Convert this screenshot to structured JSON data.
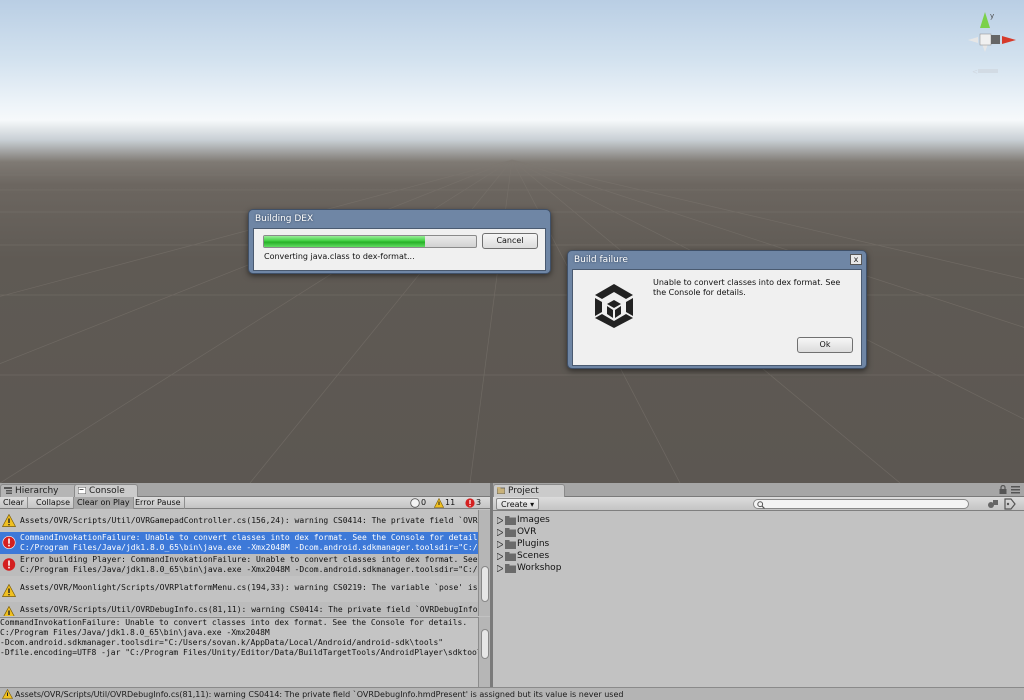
{
  "scene": {
    "gizmo": {
      "axis_y": "y",
      "label": "<"
    }
  },
  "dialogs": {
    "building_dex": {
      "title": "Building DEX",
      "progress_fraction": 0.76,
      "cancel_label": "Cancel",
      "status": "Converting java.class to dex-format..."
    },
    "build_failure": {
      "title": "Build failure",
      "close_label": "x",
      "message": "Unable to convert classes into dex format. See the Console for details.",
      "ok_label": "Ok"
    }
  },
  "left_panel": {
    "tabs": [
      {
        "label": "Hierarchy"
      },
      {
        "label": "Console"
      }
    ],
    "toolbar": {
      "clear": "Clear",
      "collapse": "Collapse",
      "clear_on_play": "Clear on Play",
      "error_pause": "Error Pause",
      "info_count": "0",
      "warning_count": "11",
      "error_count": "3"
    },
    "log": [
      {
        "type": "warning",
        "lines": [
          "Assets/OVR/Scripts/Util/OVRGamepadController.cs(156,24): warning CS0414: The private field `OVRGam"
        ]
      },
      {
        "type": "error",
        "selected": true,
        "lines": [
          "CommandInvokationFailure: Unable to convert classes into dex format. See the Console for details.",
          "C:/Program Files/Java/jdk1.8.0_65\\bin\\java.exe -Xmx2048M -Dcom.android.sdkmanager.toolsdir=\"C:/Us"
        ]
      },
      {
        "type": "error",
        "lines": [
          "Error building Player: CommandInvokationFailure: Unable to convert classes into dex format. See the Con",
          "C:/Program Files/Java/jdk1.8.0_65\\bin\\java.exe -Xmx2048M -Dcom.android.sdkmanager.toolsdir=\"C:/Us"
        ]
      },
      {
        "type": "warning",
        "lines": [
          "Assets/OVR/Moonlight/Scripts/OVRPlatformMenu.cs(194,33): warning CS0219: The variable `pose' is assi"
        ]
      },
      {
        "type": "warning",
        "lines": [
          "Assets/OVR/Scripts/Util/OVRDebugInfo.cs(81,11): warning CS0414: The private field `OVRDebugInfo.hmd"
        ]
      }
    ],
    "detail": [
      "CommandInvokationFailure: Unable to convert classes into dex format. See the Console for details.",
      "C:/Program Files/Java/jdk1.8.0_65\\bin\\java.exe -Xmx2048M",
      "-Dcom.android.sdkmanager.toolsdir=\"C:/Users/sovan.k/AppData/Local/Android/android-sdk\\tools\"",
      "-Dfile.encoding=UTF8 -jar \"C:/Program Files/Unity/Editor/Data/BuildTargetTools/AndroidPlayer\\sdktools.jar\" -"
    ]
  },
  "right_panel": {
    "tab": "Project",
    "create_label": "Create",
    "folders": [
      "Images",
      "OVR",
      "Plugins",
      "Scenes",
      "Workshop"
    ]
  },
  "status_bar": {
    "text": "Assets/OVR/Scripts/Util/OVRDebugInfo.cs(81,11): warning CS0414: The private field `OVRDebugInfo.hmdPresent' is assigned but its value is never used"
  },
  "colors": {
    "selection": "#3d79d8",
    "progress": "#3fcf3f",
    "warning": "#f0c020",
    "error": "#d42020",
    "dialog_frame": "#6f86a5"
  }
}
